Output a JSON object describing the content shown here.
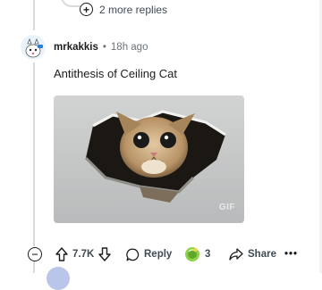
{
  "thread": {
    "more_replies_label": "2 more replies"
  },
  "comment": {
    "username": "mrkakkis",
    "separator": "•",
    "time_ago": "18h ago",
    "text": "Antithesis of Ceiling Cat",
    "media": {
      "type_badge": "GIF"
    },
    "actions": {
      "vote_count": "7.7K",
      "reply_label": "Reply",
      "award_count": "3",
      "share_label": "Share",
      "more_label": "•••"
    }
  },
  "icons": {
    "plus": "plus-circle-icon",
    "minus": "collapse-icon",
    "upvote": "arrow-up-icon",
    "downvote": "arrow-down-icon",
    "reply": "chat-bubble-icon",
    "award": "award-icon",
    "share": "share-arrow-icon"
  },
  "colors": {
    "text_primary": "#1c1c1c",
    "text_secondary": "#3f4b55",
    "thread_line": "#d8dadd",
    "award_green": "#6fc62b"
  }
}
